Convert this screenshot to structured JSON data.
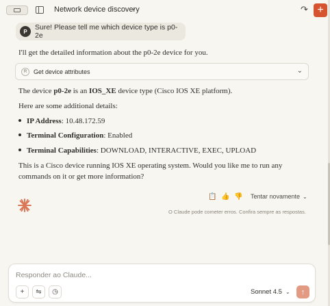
{
  "header": {
    "title": "Network device discovery"
  },
  "conversation": {
    "user_message": {
      "avatar_initial": "P",
      "text": "Sure! Please tell me which device type is p0-2e"
    },
    "assistant": {
      "intro": "I'll get the detailed information about the p0-2e device for you.",
      "tool_call": {
        "badge": "R",
        "label": "Get device attributes"
      },
      "summary": {
        "prefix": "The device ",
        "device": "p0-2e",
        "middle": " is an ",
        "type": "IOS_XE",
        "suffix": " device type (Cisco IOS XE platform)."
      },
      "details_heading": "Here are some additional details:",
      "details": [
        {
          "label": "IP Address",
          "value": ": 10.48.172.59"
        },
        {
          "label": "Terminal Configuration",
          "value": ": Enabled"
        },
        {
          "label": "Terminal Capabilities",
          "value": ": DOWNLOAD, INTERACTIVE, EXEC, UPLOAD"
        }
      ],
      "closing_line1": "This is a Cisco device running IOS XE operating system. Would you like me to run any",
      "closing_line2": "commands on it or get more information?"
    },
    "actions": {
      "retry_label": "Tentar novamente"
    },
    "disclaimer": "O Claude pode cometer erros. Confira sempre as respostas."
  },
  "composer": {
    "placeholder": "Responder ao Claude...",
    "value": "",
    "model": "Sonnet 4.5"
  },
  "icons": {
    "sidebar": "sidebar-toggle-icon",
    "panel": "panel-icon",
    "share": "share-icon",
    "new_chat": "plus-icon",
    "copy": "copy-icon",
    "thumbs_up": "thumbs-up-icon",
    "thumbs_down": "thumbs-down-icon",
    "logo": "claude-logo-icon",
    "attach": "plus-icon",
    "tools": "sliders-icon",
    "history": "clock-icon",
    "send": "arrow-up-icon"
  },
  "colors": {
    "accent": "#d5532f",
    "send_disabled": "#e39a82",
    "background": "#f8f6f1"
  }
}
